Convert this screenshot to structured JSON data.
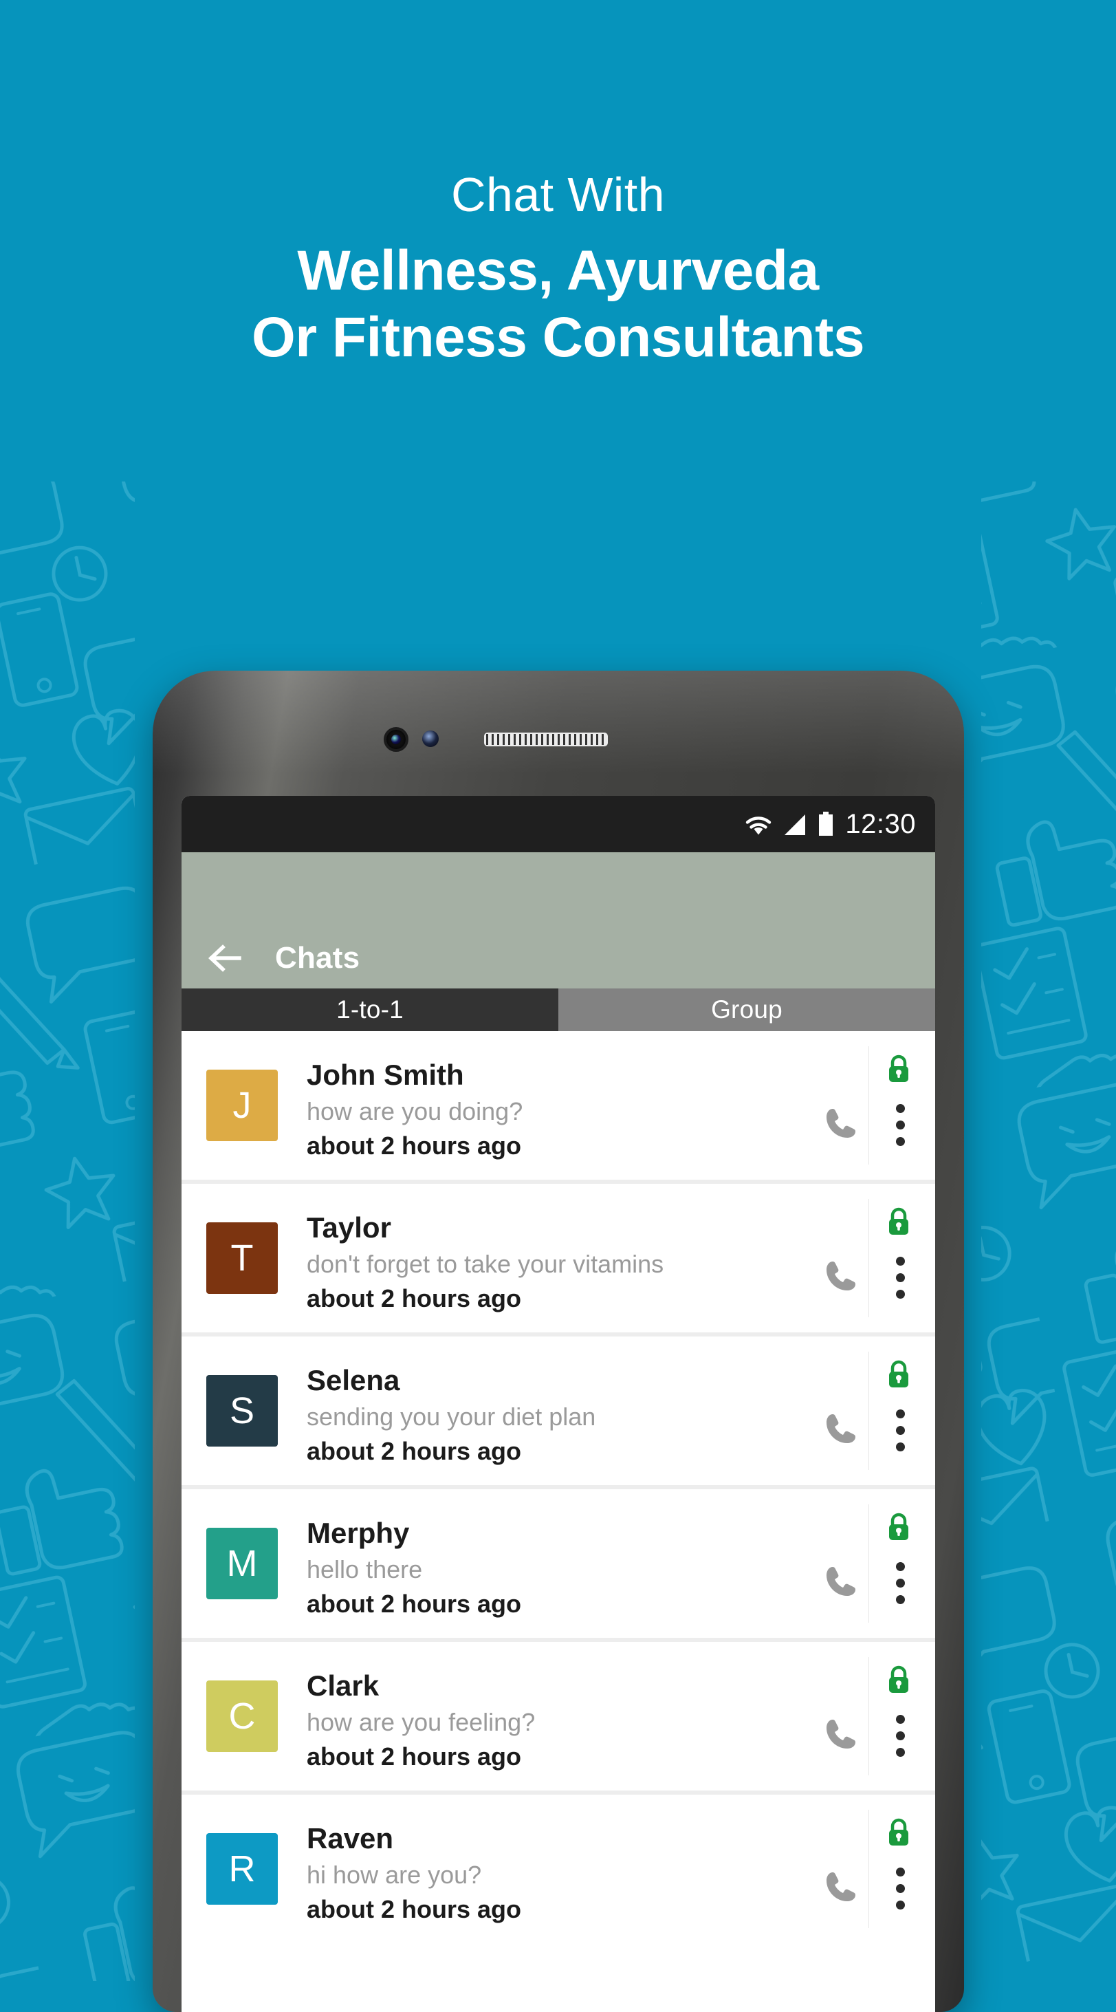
{
  "theme": {
    "background_color": "#0694bc",
    "appbar_color": "#a5b0a4",
    "tab_active_color": "#333333",
    "tab_inactive_color": "#828282",
    "lock_color": "#1a9a3d",
    "phone_icon_color": "#9a9a9a"
  },
  "promo": {
    "line1": "Chat With",
    "line2": "Wellness, Ayurveda",
    "line3": "Or Fitness Consultants"
  },
  "status_bar": {
    "time": "12:30",
    "wifi_icon": "wifi-icon",
    "signal_icon": "cellular-signal-icon",
    "battery_icon": "battery-full-icon"
  },
  "app_bar": {
    "back_icon": "back-arrow-icon",
    "title": "Chats"
  },
  "tabs": [
    {
      "label": "1-to-1",
      "active": true
    },
    {
      "label": "Group",
      "active": false
    }
  ],
  "chat_list": {
    "row_icons": {
      "lock": "lock-closed-icon",
      "call": "phone-call-icon",
      "menu": "overflow-menu-icon"
    },
    "rows": [
      {
        "initial": "J",
        "avatar_color": "#ddab45",
        "name": "John Smith",
        "message": "how are you doing?",
        "time": "about 2 hours ago"
      },
      {
        "initial": "T",
        "avatar_color": "#7c3410",
        "name": "Taylor",
        "message": "don't forget to take your vitamins",
        "time": "about 2 hours ago"
      },
      {
        "initial": "S",
        "avatar_color": "#233b47",
        "name": "Selena",
        "message": "sending you your diet plan",
        "time": "about 2 hours ago"
      },
      {
        "initial": "M",
        "avatar_color": "#23a08a",
        "name": "Merphy",
        "message": "hello there",
        "time": "about 2 hours ago"
      },
      {
        "initial": "C",
        "avatar_color": "#cfcc5f",
        "name": "Clark",
        "message": "how are you feeling?",
        "time": "about 2 hours ago"
      },
      {
        "initial": "R",
        "avatar_color": "#0d9ac4",
        "name": "Raven",
        "message": "hi how are you?",
        "time": "about 2 hours ago"
      }
    ]
  }
}
